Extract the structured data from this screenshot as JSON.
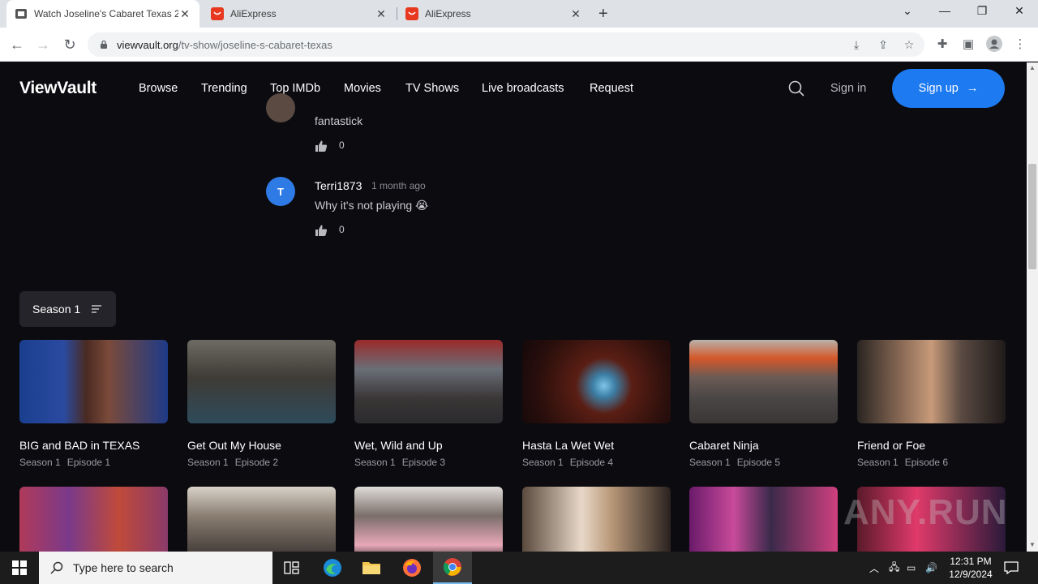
{
  "browser": {
    "tabs": [
      {
        "title": "Watch Joseline's Cabaret Texas 2",
        "active": true
      },
      {
        "title": "AliExpress",
        "active": false
      },
      {
        "title": "AliExpress",
        "active": false
      }
    ],
    "url_host": "viewvault.org",
    "url_path": "/tv-show/joseline-s-cabaret-texas"
  },
  "site": {
    "logo": "ViewVault",
    "nav": [
      "Browse",
      "Trending",
      "Top IMDb",
      "Movies",
      "TV Shows",
      "Live broadcasts",
      "Request"
    ],
    "signin": "Sign in",
    "signup": "Sign up"
  },
  "comments": [
    {
      "text": "fantastick",
      "likes": "0"
    },
    {
      "avatar_letter": "T",
      "user": "Terri1873",
      "time": "1 month ago",
      "text": "Why it's not playing 😭",
      "likes": "0"
    }
  ],
  "season": {
    "label": "Season 1"
  },
  "episodes": [
    {
      "title": "BIG and BAD in TEXAS",
      "season": "Season 1",
      "episode": "Episode 1"
    },
    {
      "title": "Get Out My House",
      "season": "Season 1",
      "episode": "Episode 2"
    },
    {
      "title": "Wet, Wild and Up",
      "season": "Season 1",
      "episode": "Episode 3"
    },
    {
      "title": "Hasta La Wet Wet",
      "season": "Season 1",
      "episode": "Episode 4"
    },
    {
      "title": "Cabaret Ninja",
      "season": "Season 1",
      "episode": "Episode 5"
    },
    {
      "title": "Friend or Foe",
      "season": "Season 1",
      "episode": "Episode 6"
    }
  ],
  "watermark": "ANY.RUN",
  "taskbar": {
    "search_placeholder": "Type here to search",
    "time": "12:31 PM",
    "date": "12/9/2024"
  },
  "colors": {
    "accent": "#1d7af0",
    "background": "#0b0b10",
    "avatar": "#2f7be5"
  }
}
